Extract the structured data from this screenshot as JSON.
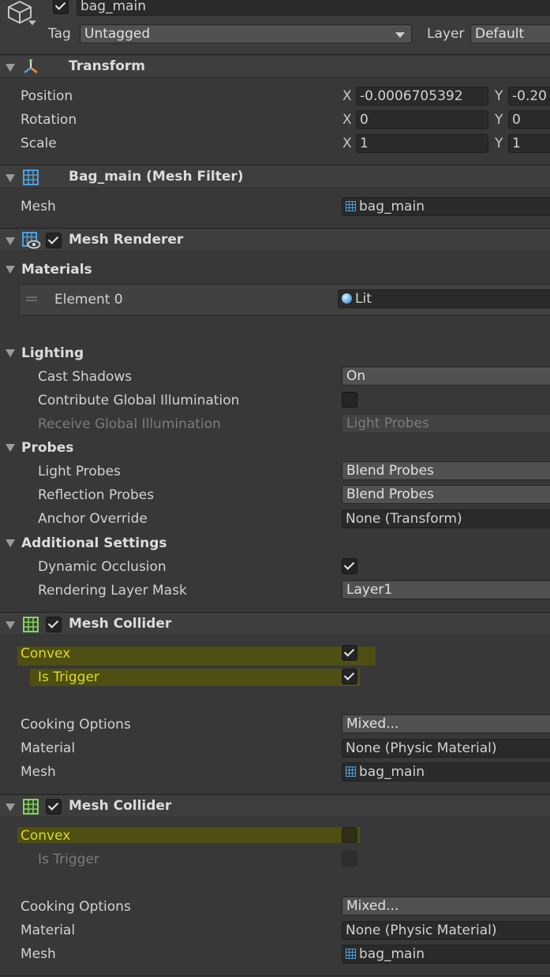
{
  "object": {
    "active": true,
    "name": "bag_main",
    "tag_label": "Tag",
    "tag_value": "Untagged",
    "layer_label": "Layer",
    "layer_value": "Default"
  },
  "transform": {
    "title": "Transform",
    "position_label": "Position",
    "rotation_label": "Rotation",
    "scale_label": "Scale",
    "x_label": "X",
    "y_label": "Y",
    "position": {
      "x": "-0.0006705392",
      "y": "-0.20"
    },
    "rotation": {
      "x": "0",
      "y": "0"
    },
    "scale": {
      "x": "1",
      "y": "1"
    }
  },
  "mesh_filter": {
    "title": "Bag_main (Mesh Filter)",
    "mesh_label": "Mesh",
    "mesh_value": "bag_main"
  },
  "mesh_renderer": {
    "title": "Mesh Renderer",
    "enabled": true,
    "materials_label": "Materials",
    "element_label": "Element 0",
    "element_value": "Lit",
    "lighting_label": "Lighting",
    "cast_shadows_label": "Cast Shadows",
    "cast_shadows_value": "On",
    "contribute_gi_label": "Contribute Global Illumination",
    "contribute_gi": false,
    "receive_gi_label": "Receive Global Illumination",
    "receive_gi_value": "Light Probes",
    "probes_label": "Probes",
    "light_probes_label": "Light Probes",
    "light_probes_value": "Blend Probes",
    "reflection_probes_label": "Reflection Probes",
    "reflection_probes_value": "Blend Probes",
    "anchor_override_label": "Anchor Override",
    "anchor_override_value": "None (Transform)",
    "additional_label": "Additional Settings",
    "dynamic_occlusion_label": "Dynamic Occlusion",
    "dynamic_occlusion": true,
    "rendering_layer_label": "Rendering Layer Mask",
    "rendering_layer_value": "Layer1"
  },
  "mesh_collider_1": {
    "title": "Mesh Collider",
    "enabled": true,
    "convex_label": "Convex",
    "convex": true,
    "is_trigger_label": "Is Trigger",
    "is_trigger": true,
    "cooking_label": "Cooking Options",
    "cooking_value": "Mixed...",
    "material_label": "Material",
    "material_value": "None (Physic Material)",
    "mesh_label": "Mesh",
    "mesh_value": "bag_main"
  },
  "mesh_collider_2": {
    "title": "Mesh Collider",
    "enabled": true,
    "convex_label": "Convex",
    "convex": false,
    "is_trigger_label": "Is Trigger",
    "is_trigger": false,
    "cooking_label": "Cooking Options",
    "cooking_value": "Mixed...",
    "material_label": "Material",
    "material_value": "None (Physic Material)",
    "mesh_label": "Mesh",
    "mesh_value": "bag_main"
  },
  "colors": {
    "highlight": "#4f4f13",
    "highlight_text": "#dada2a",
    "mesh_icon": "#4aa3df",
    "collider_icon": "#7ed957"
  },
  "icons": [
    "gameobject-cube-icon",
    "transform-gizmo-icon",
    "mesh-filter-grid-icon",
    "mesh-renderer-icon",
    "mesh-collider-grid-icon",
    "material-sphere-icon",
    "drag-handle-icon"
  ]
}
